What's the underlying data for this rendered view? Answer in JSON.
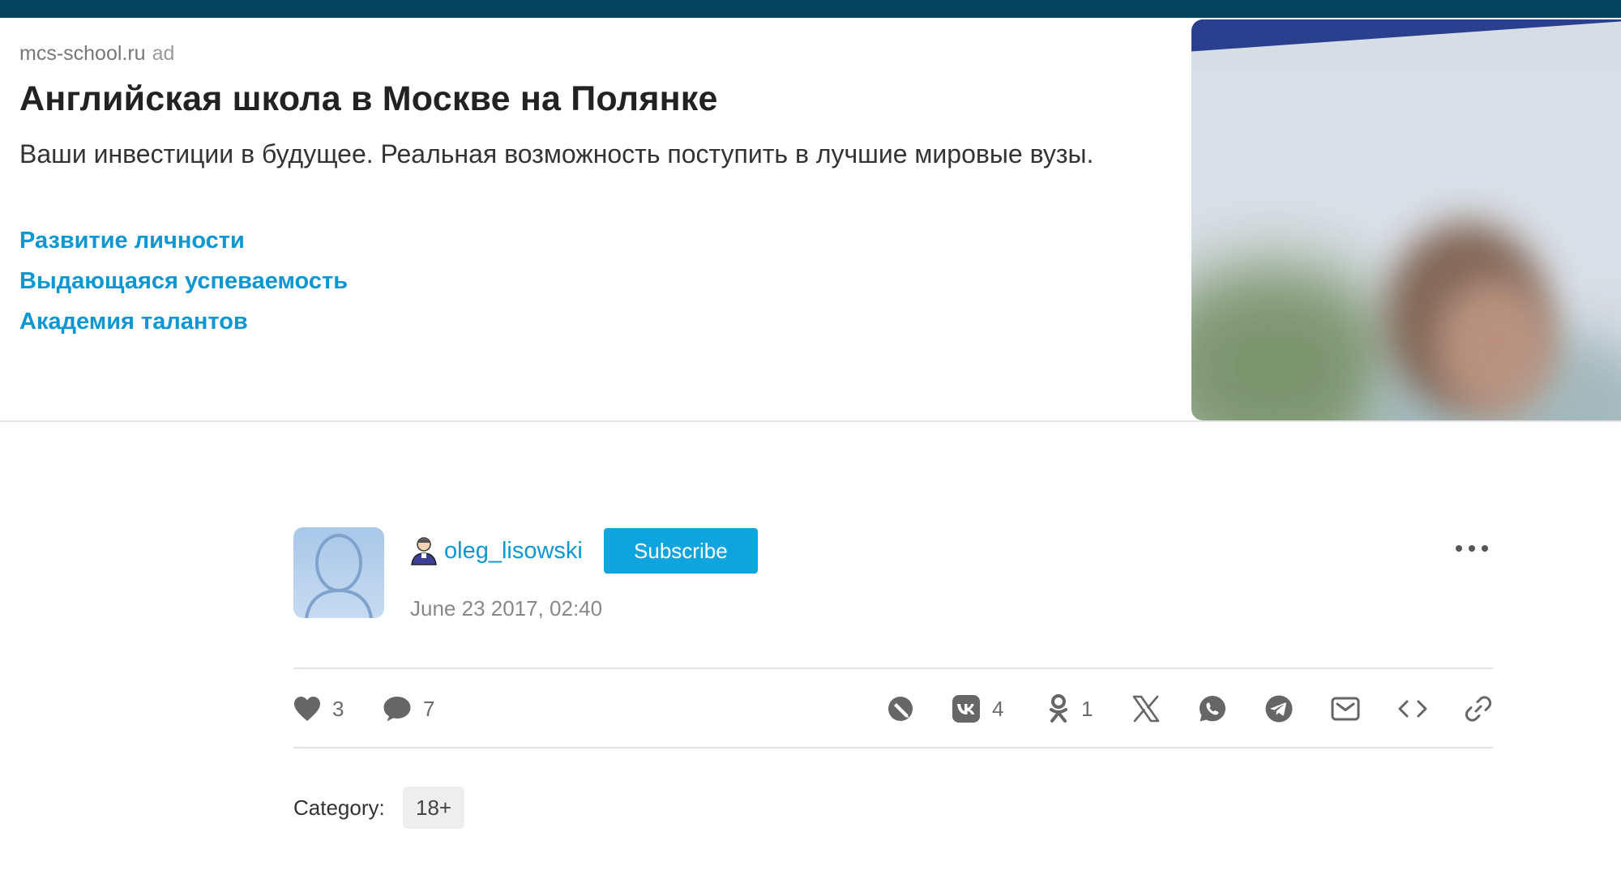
{
  "ad": {
    "source": "mcs-school.ru",
    "label": "ad",
    "title": "Английская школа в Москве на Полянке",
    "text": "Ваши инвестиции в будущее. Реальная возможность поступить в лучшие мировые вузы.",
    "links": [
      "Развитие личности",
      "Выдающаяся успеваемость",
      "Академия талантов"
    ]
  },
  "post": {
    "author": "oleg_lisowski",
    "subscribe_label": "Subscribe",
    "date": "June 23 2017, 02:40"
  },
  "actions": {
    "likes": "3",
    "comments": "7",
    "vk_count": "4",
    "ok_count": "1"
  },
  "category": {
    "label": "Category:",
    "tag": "18+"
  },
  "icons": {
    "like": "heart-icon",
    "comment": "comment-icon",
    "livejournal": "livejournal-icon",
    "vk": "vk-icon",
    "ok": "odnoklassniki-icon",
    "x": "x-icon",
    "whatsapp": "whatsapp-icon",
    "telegram": "telegram-icon",
    "email": "email-icon",
    "embed": "embed-icon",
    "link": "link-icon",
    "more": "more-icon"
  },
  "colors": {
    "top_bar": "#04435c",
    "link": "#0c97d3",
    "subscribe": "#0ea4dd",
    "icon": "#666666"
  }
}
